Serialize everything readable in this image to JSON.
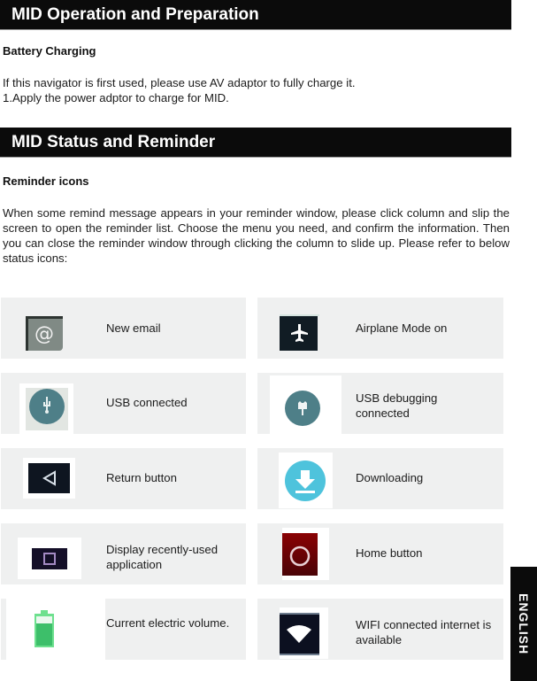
{
  "sections": [
    {
      "title": "MID Operation and Preparation",
      "subheading": "Battery Charging",
      "paragraphs": [
        "If this navigator is first used, please use AV adaptor to fully charge it.",
        "1.Apply the power adptor to charge for MID."
      ]
    },
    {
      "title": "MID Status and Reminder",
      "subheading": "Reminder icons",
      "paragraph": "When some remind message appears in your reminder window, please click column and slip the screen to open the reminder list. Choose the menu you need, and confirm the information. Then you can close the reminder window through clicking the column to slide up. Please refer to below status icons:"
    }
  ],
  "status_icons": [
    {
      "icon": "email-icon",
      "label": "New email"
    },
    {
      "icon": "airplane-icon",
      "label": "Airplane Mode on"
    },
    {
      "icon": "usb-icon",
      "label": "USB connected"
    },
    {
      "icon": "usb-debugging-icon",
      "label": "USB debugging connected"
    },
    {
      "icon": "back-icon",
      "label": "Return button"
    },
    {
      "icon": "download-icon",
      "label": "Downloading"
    },
    {
      "icon": "recent-apps-icon",
      "label": "Display recently-used application"
    },
    {
      "icon": "home-icon",
      "label": "Home button"
    },
    {
      "icon": "battery-icon",
      "label": "Current electric volume."
    },
    {
      "icon": "wifi-icon",
      "label": "WIFI connected internet is available"
    }
  ],
  "side_tab": "ENGLISH",
  "colors": {
    "header_bg": "#0b0b0b",
    "card_bg": "#eff0f0",
    "usb_teal": "#4e7f88",
    "download_cyan": "#4ec3dc",
    "home_red": "#7a0406",
    "battery_green": "#3dbf6a"
  }
}
